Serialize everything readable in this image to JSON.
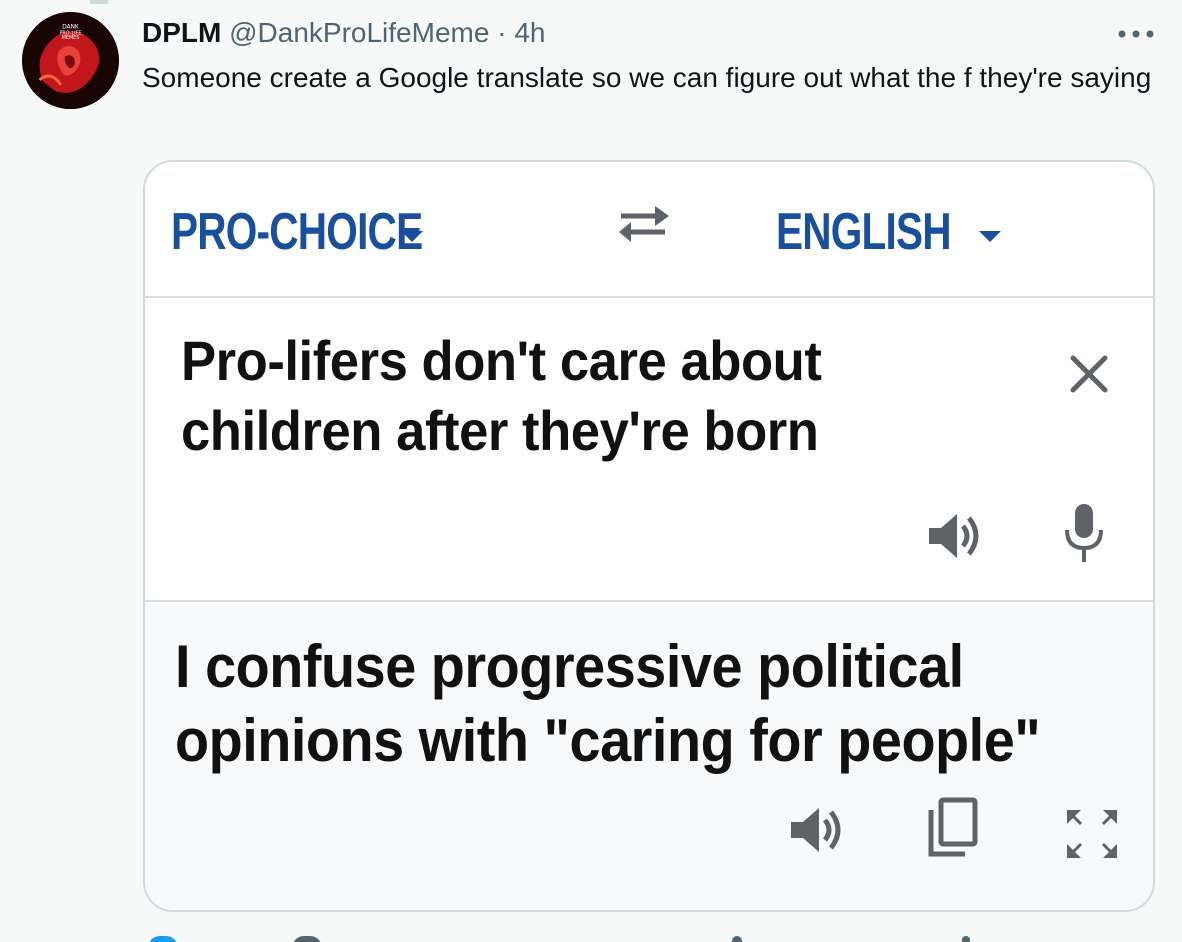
{
  "tweet": {
    "display_name": "DPLM",
    "handle": "@DankProLifeMeme",
    "separator": "·",
    "time": "4h",
    "text": "Someone create a Google translate so we can figure out what the f they're saying",
    "avatar_text": "DANK PRO-LIFE MEMES"
  },
  "media": {
    "source_language": "PRO-CHOICE",
    "target_language": "ENGLISH",
    "input_text": "Pro-lifers don't care about children after they're born",
    "output_text": "I confuse progressive political opinions with \"caring for people\"",
    "icons": [
      "swap-icon",
      "close-icon",
      "speaker-icon",
      "mic-icon",
      "copy-icon",
      "fullscreen-icon"
    ]
  },
  "colors": {
    "background": "#f7f9f9",
    "language_blue": "#1a4f9c",
    "icon_gray": "#5f6368",
    "text_secondary": "#536471"
  }
}
